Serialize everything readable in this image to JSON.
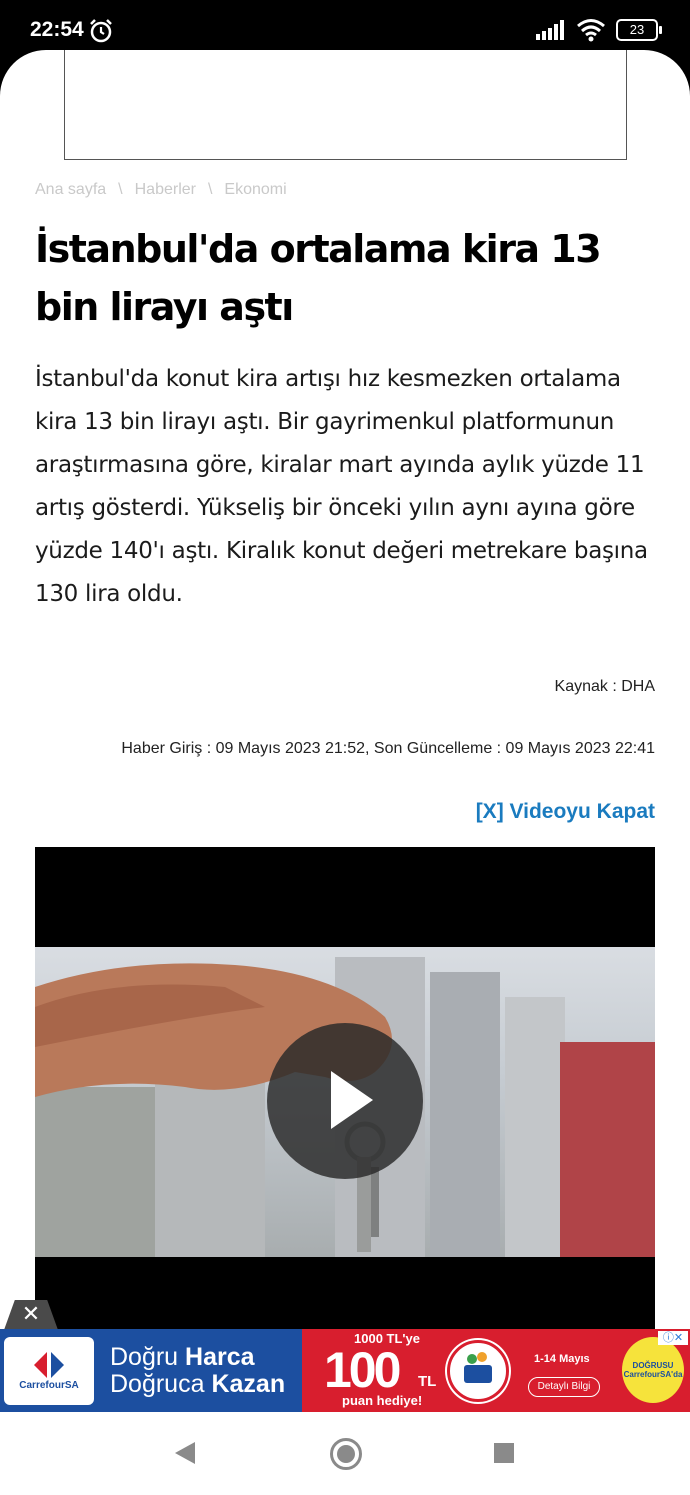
{
  "status": {
    "time": "22:54",
    "battery": "23",
    "icons": [
      "alarm-icon",
      "signal-icon",
      "wifi-icon",
      "battery-icon"
    ]
  },
  "breadcrumb": {
    "items": [
      "Ana sayfa",
      "Haberler",
      "Ekonomi"
    ],
    "separator": "\\"
  },
  "article": {
    "title": "İstanbul'da ortalama kira 13 bin lirayı aştı",
    "summary": "İstanbul'da konut kira artışı hız kesmezken ortalama kira 13 bin lirayı aştı. Bir gayrimenkul platformunun araştırmasına göre, kiralar mart ayında aylık yüzde 11 artış gösterdi. Yükseliş bir önceki yılın aynı ayına göre yüzde 140'ı aştı. Kiralık konut değeri metrekare başına 130 lira oldu.",
    "source": "Kaynak : DHA",
    "dates": "Haber Giriş :  09 Mayıs 2023 21:52, Son Güncelleme :  09 Mayıs 2023 22:41",
    "close_video": "[X] Videoyu Kapat"
  },
  "ad_banner": {
    "brand": "CarrefourSA",
    "slogan_line1_a": "Doğru ",
    "slogan_line1_b": "Harca",
    "slogan_line2_a": "Doğruca ",
    "slogan_line2_b": "Kazan",
    "promo_top": "1000 TL'ye",
    "promo_big": "100",
    "promo_unit": "TL",
    "promo_bottom": "puan hediye!",
    "promo_dates": "1-14 Mayıs",
    "details_button": "Detaylı Bilgi",
    "badge_line1": "DOĞRUSU",
    "badge_line2": "CarrefourSA'da",
    "close_label": "✕",
    "adchoices": "ⓘ✕"
  },
  "colors": {
    "link": "#1a7bbf",
    "ad_blue": "#1c4fa0",
    "ad_red": "#d81e2e"
  }
}
